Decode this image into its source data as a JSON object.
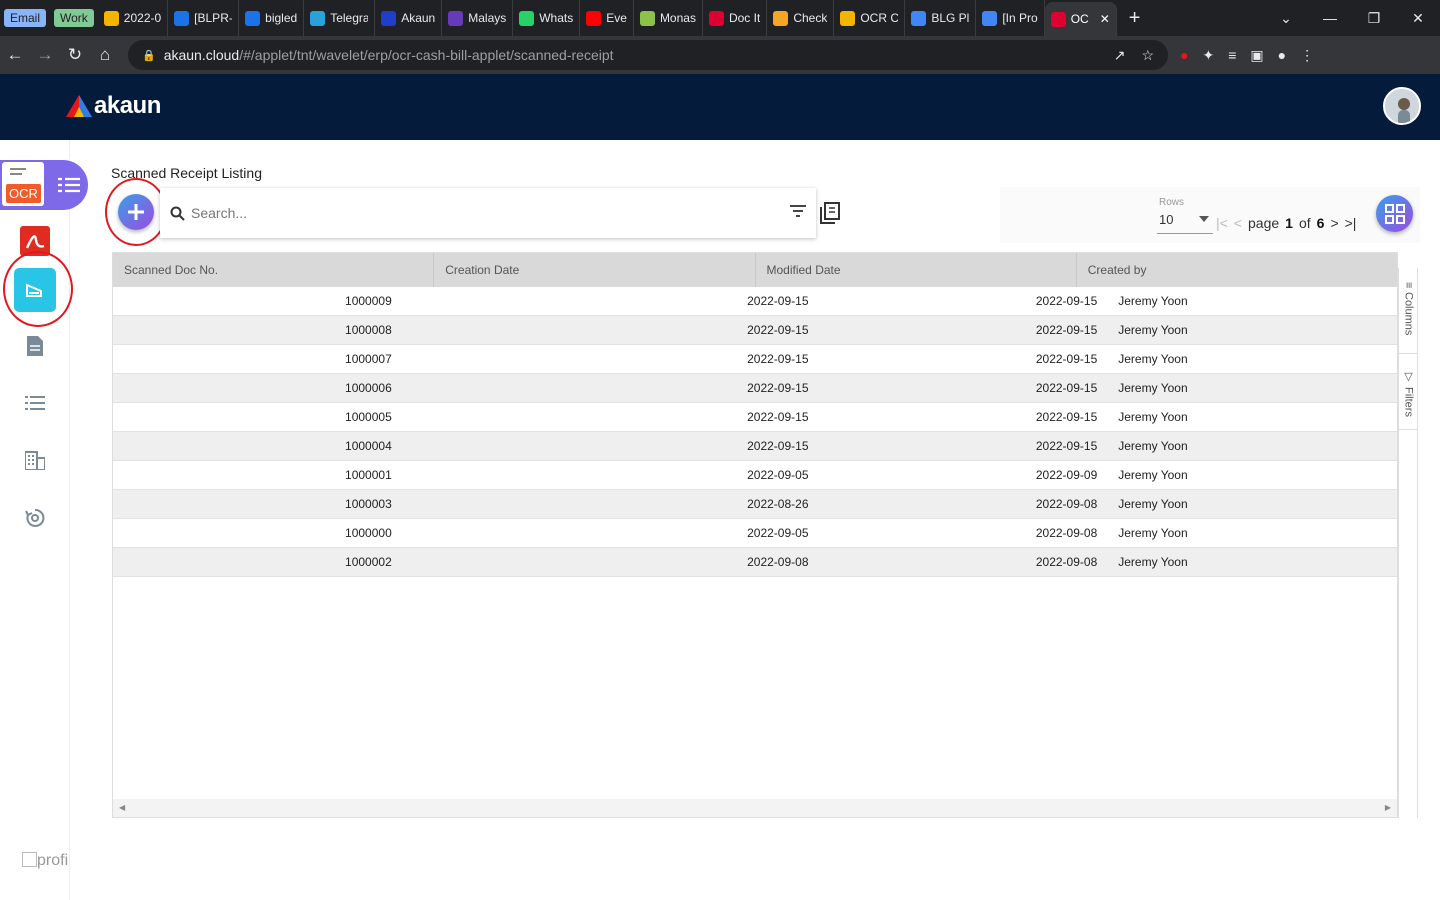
{
  "browser": {
    "tabs": [
      {
        "label": "Email",
        "type": "group",
        "color": "#8ab4f8"
      },
      {
        "label": "Work",
        "type": "group",
        "color": "#81c995"
      },
      {
        "label": "2022-0",
        "icon": "google-drive-icon",
        "color": "#f4b400"
      },
      {
        "label": "[BLPR-",
        "icon": "circle-icon",
        "color": "#1a73e8"
      },
      {
        "label": "bigled",
        "icon": "bookmark-icon",
        "color": "#1a73e8"
      },
      {
        "label": "Telegra",
        "icon": "telegram-icon",
        "color": "#2aa1da"
      },
      {
        "label": "Akaun",
        "icon": "akaun-icon",
        "color": "#1e40c8"
      },
      {
        "label": "Malays",
        "icon": "form-icon",
        "color": "#673ab7"
      },
      {
        "label": "Whats",
        "icon": "whatsapp-icon",
        "color": "#25d366"
      },
      {
        "label": "Eve",
        "icon": "youtube-icon",
        "color": "#ff0000"
      },
      {
        "label": "Monas",
        "icon": "leaf-icon",
        "color": "#8bc34a"
      },
      {
        "label": "Doc It",
        "icon": "angular-icon",
        "color": "#dd0031"
      },
      {
        "label": "Check",
        "icon": "shield-icon",
        "color": "#f5a623"
      },
      {
        "label": "OCR C",
        "icon": "google-drive-icon",
        "color": "#f4b400"
      },
      {
        "label": "BLG Pl",
        "icon": "docs-icon",
        "color": "#4285f4"
      },
      {
        "label": "[In Pro",
        "icon": "docs-icon",
        "color": "#4285f4"
      },
      {
        "label": "OC",
        "icon": "angular-icon",
        "color": "#dd0031",
        "active": true
      }
    ],
    "url_host": "akaun.cloud",
    "url_path": "/#/applet/tnt/wavelet/erp/ocr-cash-bill-applet/scanned-receipt"
  },
  "app": {
    "logo_text": "akaun"
  },
  "sidebar": {
    "ocr_label": "OCR",
    "profile_label": "profi"
  },
  "page": {
    "title": "Scanned Receipt Listing",
    "search_placeholder": "Search...",
    "rows_label": "Rows",
    "rows_value": "10",
    "page_word": "page",
    "page_current": "1",
    "of_word": "of",
    "page_total": "6"
  },
  "grid": {
    "columns": [
      "Scanned Doc No.",
      "Creation Date",
      "Modified Date",
      "Created by"
    ],
    "rows": [
      [
        "1000009",
        "2022-09-15",
        "2022-09-15",
        "Jeremy Yoon"
      ],
      [
        "1000008",
        "2022-09-15",
        "2022-09-15",
        "Jeremy Yoon"
      ],
      [
        "1000007",
        "2022-09-15",
        "2022-09-15",
        "Jeremy Yoon"
      ],
      [
        "1000006",
        "2022-09-15",
        "2022-09-15",
        "Jeremy Yoon"
      ],
      [
        "1000005",
        "2022-09-15",
        "2022-09-15",
        "Jeremy Yoon"
      ],
      [
        "1000004",
        "2022-09-15",
        "2022-09-15",
        "Jeremy Yoon"
      ],
      [
        "1000001",
        "2022-09-05",
        "2022-09-09",
        "Jeremy Yoon"
      ],
      [
        "1000003",
        "2022-08-26",
        "2022-09-08",
        "Jeremy Yoon"
      ],
      [
        "1000000",
        "2022-09-05",
        "2022-09-08",
        "Jeremy Yoon"
      ],
      [
        "1000002",
        "2022-09-08",
        "2022-09-08",
        "Jeremy Yoon"
      ]
    ],
    "side_tabs": [
      "Columns",
      "Filters"
    ]
  },
  "colors": {
    "header_bg": "#051b3b",
    "accent": "#29c5e6",
    "annotation": "#e3181d"
  }
}
